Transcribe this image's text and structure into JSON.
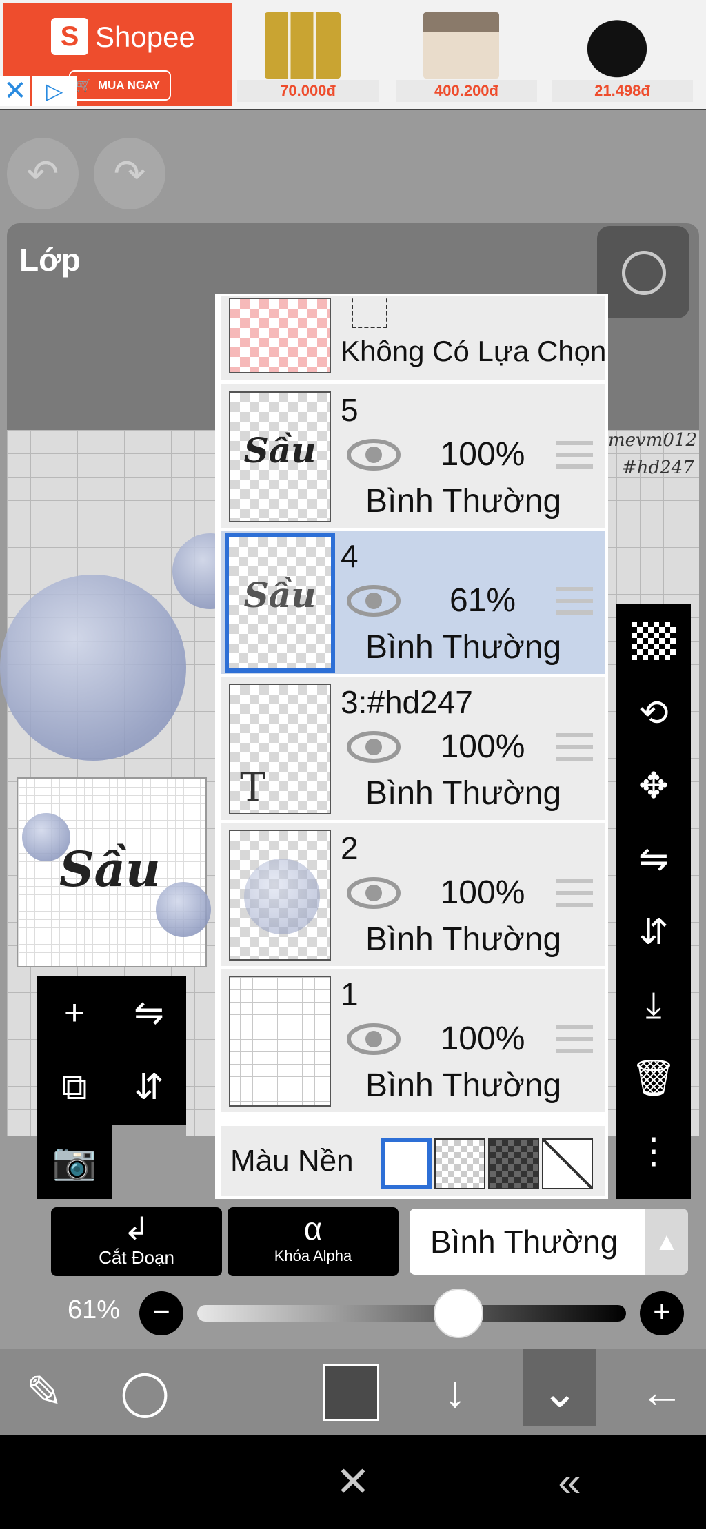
{
  "ad": {
    "brand": "Shopee",
    "buy_label": "MUA NGAY",
    "close_icon": "close-icon",
    "play_icon": "adchoices-play-icon",
    "products": [
      {
        "price": "70.000đ"
      },
      {
        "price": "400.200đ"
      },
      {
        "price": "21.498đ"
      }
    ]
  },
  "top": {
    "undo_glyph": "↶",
    "redo_glyph": "↷"
  },
  "panel": {
    "title": "Lớp"
  },
  "canvas": {
    "watermark_line1": "mevm012",
    "watermark_line2": "#hd247",
    "artwork_text": "Sầu"
  },
  "selection_row": {
    "label": "Không Có Lựa Chọn"
  },
  "layers": [
    {
      "name": "5",
      "opacity": "100%",
      "blend": "Bình Thường",
      "selected": false
    },
    {
      "name": "4",
      "opacity": "61%",
      "blend": "Bình Thường",
      "selected": true
    },
    {
      "name": "3:#hd247",
      "opacity": "100%",
      "blend": "Bình Thường",
      "selected": false
    },
    {
      "name": "2",
      "opacity": "100%",
      "blend": "Bình Thường",
      "selected": false
    },
    {
      "name": "1",
      "opacity": "100%",
      "blend": "Bình Thường",
      "selected": false
    }
  ],
  "thumb_texts": {
    "layer5": "Sầu",
    "layer4": "Sầu",
    "layer3_glyph": "T"
  },
  "background": {
    "label": "Màu Nền",
    "selected": "white"
  },
  "actions": {
    "clip_label": "Cắt Đoạn",
    "clip_icon": "↲",
    "alpha_label": "Khóa Alpha",
    "alpha_icon": "α",
    "blend_mode": "Bình Thường",
    "blend_arrow": "▲"
  },
  "opacity_slider": {
    "label": "61%",
    "value": 0.61,
    "minus": "−",
    "plus": "+"
  },
  "left_tools": {
    "add": "+",
    "flip_h": "⇋",
    "add_copy": "⧉",
    "flip_v": "⇵",
    "camera": "📷"
  },
  "right_tools": {
    "move": "✥",
    "flip_h": "⇋",
    "flip_v": "⇵",
    "merge_down": "⤓",
    "delete": "🗑",
    "more": "⋮",
    "transform": "⟲"
  },
  "bottom_bar": {
    "tools": "✎",
    "lasso": "◯",
    "down": "↓",
    "expand": "⌄",
    "back": "←"
  },
  "nav": {
    "center": "✕",
    "back": "«"
  },
  "colors": {
    "accent": "#2d6fd6",
    "shopee": "#ee4d2d",
    "selected_row": "#c8d5ea"
  }
}
